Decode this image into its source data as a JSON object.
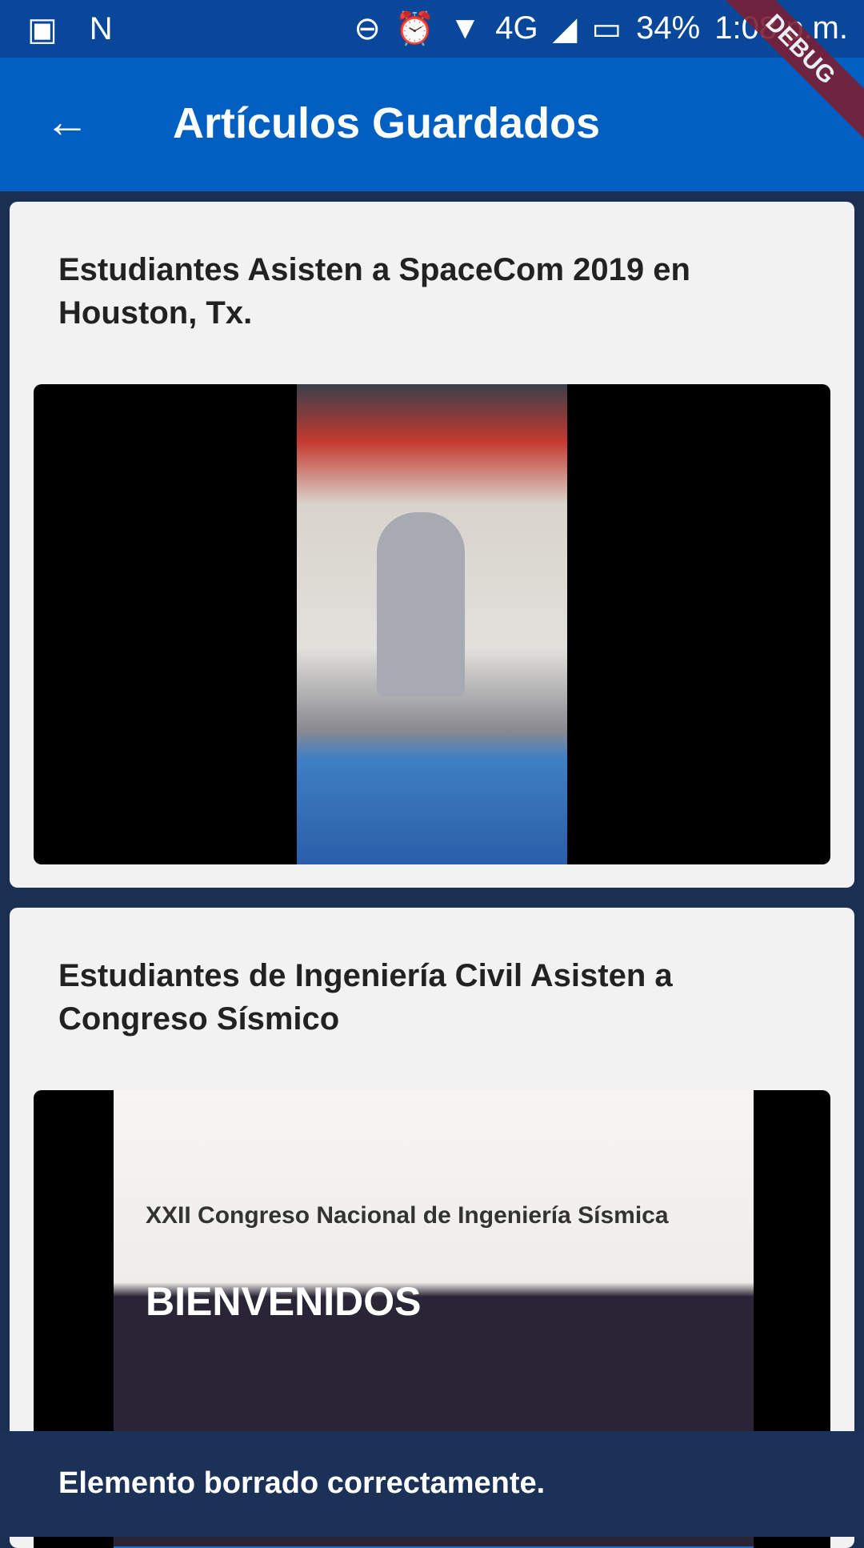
{
  "status_bar": {
    "battery": "34%",
    "time": "1:08 p.m.",
    "network": "4G"
  },
  "app_bar": {
    "title": "Artículos Guardados",
    "debug_banner": "DEBUG"
  },
  "articles": [
    {
      "title": "Estudiantes Asisten a SpaceCom 2019 en Houston, Tx."
    },
    {
      "title": "Estudiantes de Ingeniería Civil Asisten a Congreso Sísmico",
      "image_text": [
        "XXII Congreso Nacional de Ingeniería Sísmica",
        "BIENVENIDOS"
      ]
    }
  ],
  "snackbar": {
    "message": "Elemento borrado correctamente."
  },
  "colors": {
    "app_bar": "#005fc1",
    "status_bar": "#08479a",
    "background": "#1b2f52",
    "snackbar": "#1b3157"
  }
}
